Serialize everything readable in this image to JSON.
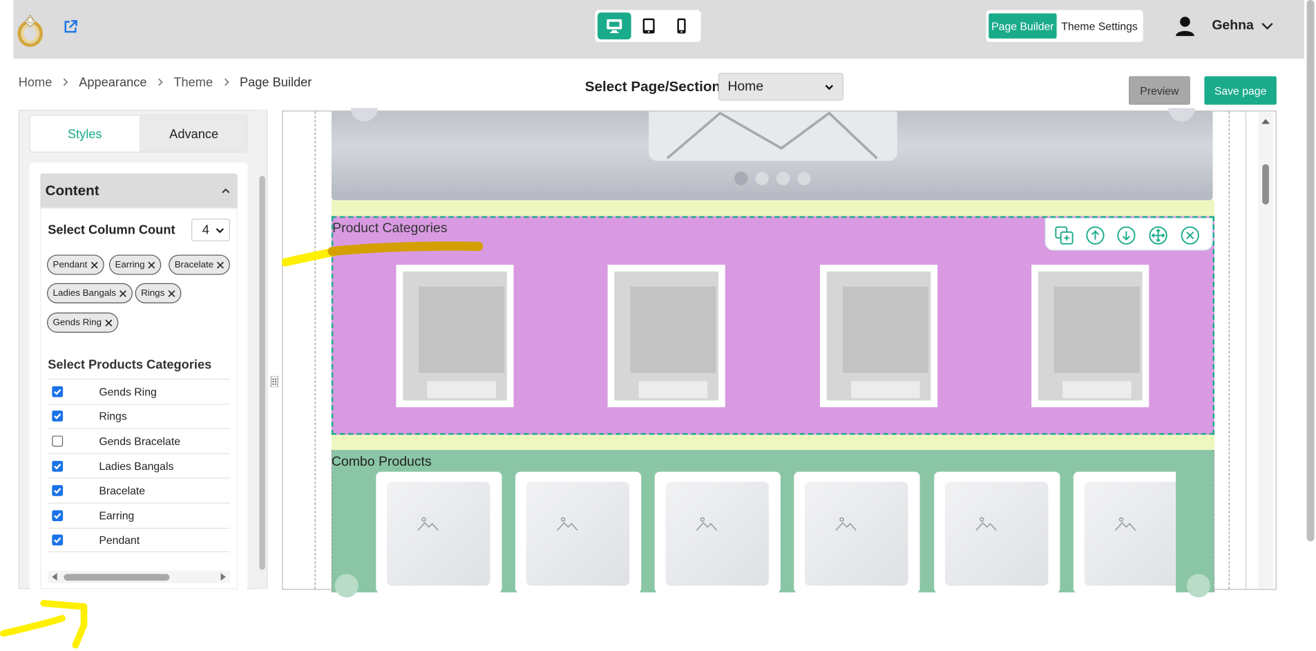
{
  "header": {
    "device_modes": [
      "desktop-icon",
      "tablet-icon",
      "mobile-icon"
    ],
    "active_device": "desktop",
    "modes": {
      "page_builder": "Page Builder",
      "theme_settings": "Theme Settings"
    },
    "user": {
      "name": "Gehna"
    }
  },
  "breadcrumb": [
    "Home",
    "Appearance",
    "Theme",
    "Page Builder"
  ],
  "page_select": {
    "label": "Select Page/Section:",
    "value": "Home"
  },
  "actions": {
    "preview": "Preview",
    "save": "Save page"
  },
  "sidebar": {
    "tabs": [
      "Styles",
      "Advance"
    ],
    "active_tab": "Styles",
    "content": {
      "title": "Content",
      "column_count_label": "Select Column Count",
      "column_count_value": "4",
      "chips": [
        "Pendant",
        "Earring",
        "Bracelate",
        "Ladies Bangals",
        "Rings",
        "Gends Ring"
      ],
      "categories_label": "Select Products Categories",
      "categories": [
        {
          "name": "Gends Ring",
          "checked": true
        },
        {
          "name": "Rings",
          "checked": true
        },
        {
          "name": "Gends Bracelate",
          "checked": false
        },
        {
          "name": "Ladies Bangals",
          "checked": true
        },
        {
          "name": "Bracelate",
          "checked": true
        },
        {
          "name": "Earring",
          "checked": true
        },
        {
          "name": "Pendant",
          "checked": true
        }
      ]
    }
  },
  "canvas": {
    "sections": {
      "product_categories": {
        "title": "Product Categories",
        "card_count": 4
      },
      "combo_products": {
        "title": "Combo Products",
        "card_count": 6
      }
    },
    "toolbar": [
      "duplicate-icon",
      "move-up-icon",
      "move-down-icon",
      "drag-move-icon",
      "close-icon"
    ]
  },
  "colors": {
    "accent": "#1aab8a",
    "topbar": "#dcdcdc",
    "category_section_bg": "#d99ae2",
    "combo_section_bg": "#8ac6a5",
    "spacer_band": "#eef7bf",
    "annotation_yellow": "#ffef00",
    "annotation_orange": "#d4a000"
  }
}
